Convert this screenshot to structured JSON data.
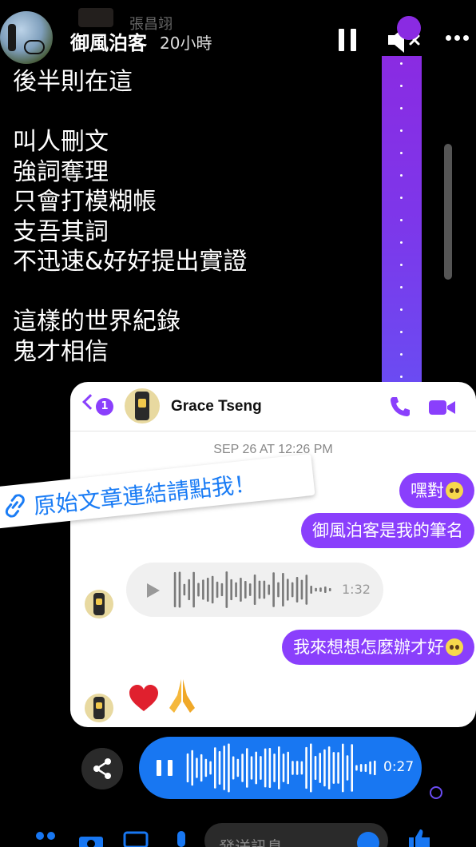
{
  "story": {
    "ghost_name": "張昌翊",
    "username": "御風泊客",
    "time_ago": "20小時",
    "text": "後半則在這\n\n叫人刪文\n強詞奪理\n只會打模糊帳\n支吾其詞\n不迅速&好好提出實證\n\n這樣的世界紀錄\n鬼才相信"
  },
  "messenger": {
    "back_count": "1",
    "contact_name": "Grace Tseng",
    "date": "SEP 26 AT 12:26 PM",
    "messages": [
      {
        "type": "out",
        "text": "嘿對"
      },
      {
        "type": "out",
        "text": "御風泊客是我的筆名"
      },
      {
        "type": "audio_in",
        "duration": "1:32"
      },
      {
        "type": "out",
        "text": "我來想想怎麼辦才好"
      }
    ],
    "reactions": [
      "heart",
      "folded-hands"
    ]
  },
  "link_sticker": {
    "text": "原始文章連結請點我！"
  },
  "outer_audio": {
    "duration": "0:27"
  },
  "composer": {
    "placeholder": "發送訊息"
  },
  "colors": {
    "messenger_purple": "#8a3ffc",
    "story_blue": "#1877f2",
    "link_blue": "#1a7cf5"
  }
}
